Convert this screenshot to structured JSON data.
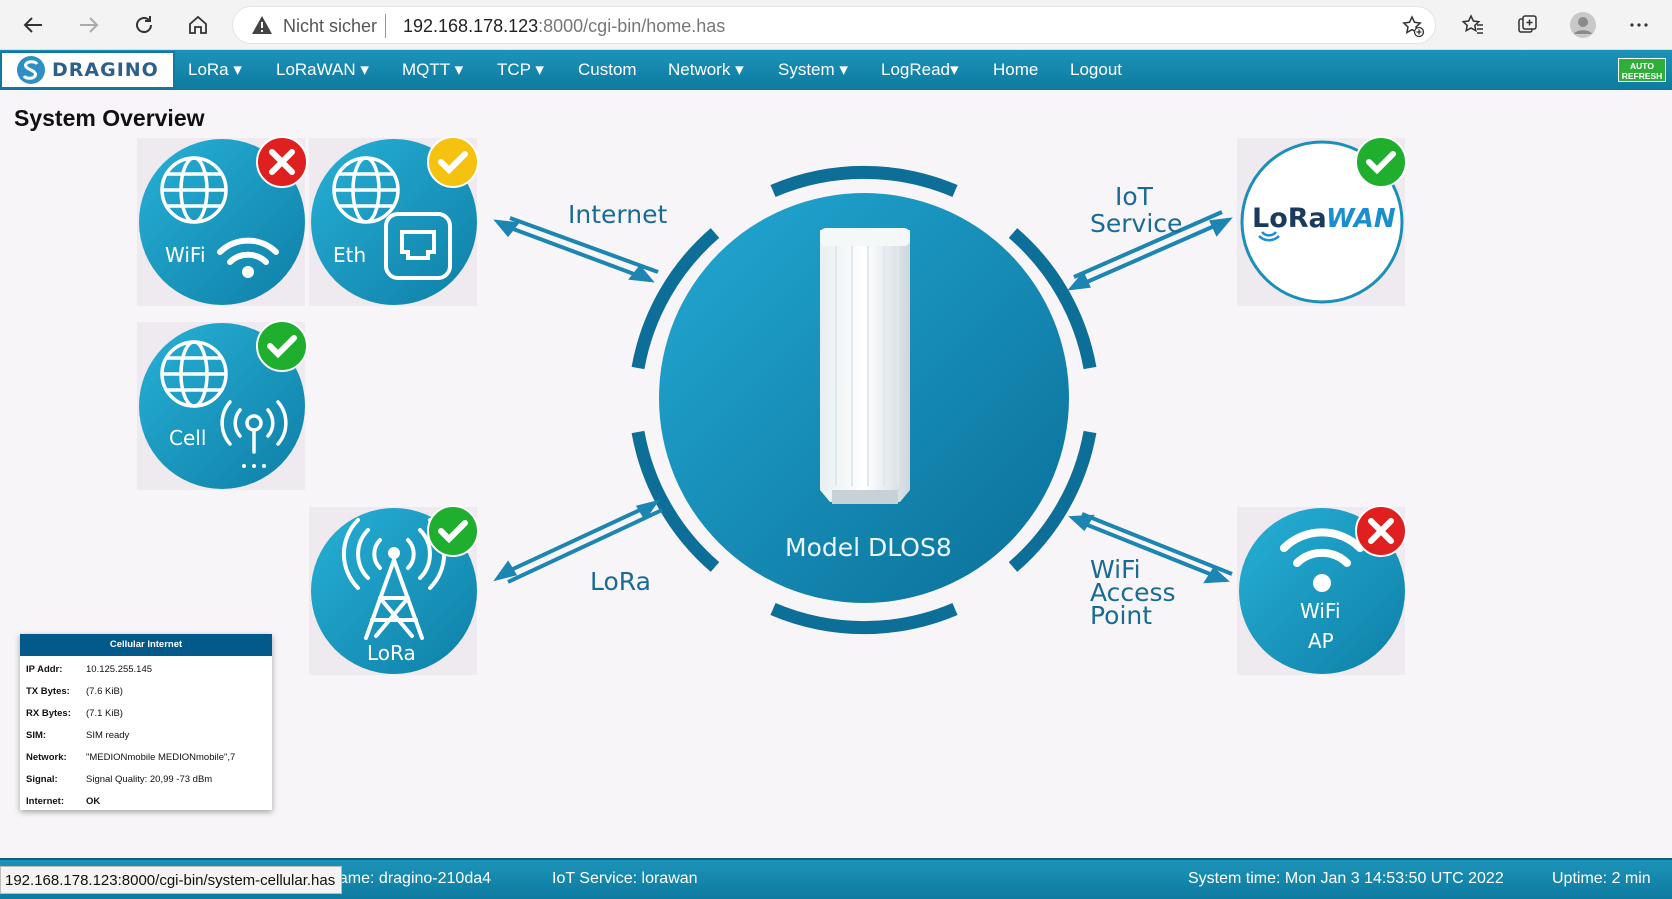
{
  "browser": {
    "security_label": "Nicht sicher",
    "url_host": "192.168.178.123",
    "url_rest": ":8000/cgi-bin/home.has"
  },
  "nav": {
    "logo_text": "DRAGINO",
    "items": [
      {
        "label": "LoRa",
        "dropdown": true
      },
      {
        "label": "LoRaWAN",
        "dropdown": true
      },
      {
        "label": "MQTT",
        "dropdown": true
      },
      {
        "label": "TCP",
        "dropdown": true
      },
      {
        "label": "Custom",
        "dropdown": false
      },
      {
        "label": "Network",
        "dropdown": true
      },
      {
        "label": "System",
        "dropdown": true
      },
      {
        "label": "LogRead",
        "dropdown": true
      },
      {
        "label": "Home",
        "dropdown": false
      },
      {
        "label": "Logout",
        "dropdown": false
      }
    ],
    "auto_refresh_line1": "AUTO",
    "auto_refresh_line2": "REFRESH"
  },
  "page_title": "System Overview",
  "overview": {
    "wifi": {
      "label": "WiFi",
      "status": "error"
    },
    "eth": {
      "label": "Eth",
      "status": "warning"
    },
    "cell": {
      "label": "Cell",
      "status": "ok"
    },
    "lora": {
      "label": "LoRa",
      "status": "ok"
    },
    "lorawan": {
      "logo_left": "LoRa",
      "logo_right": "WAN",
      "status": "ok"
    },
    "wifi_ap": {
      "label_line1": "WiFi",
      "label_line2": "AP",
      "status": "error"
    },
    "device_model": "Model DLOS8",
    "labels": {
      "internet": "Internet",
      "iot_line1": "IoT",
      "iot_line2": "Service",
      "lora": "LoRa",
      "wifi_ap_line1": "WiFi",
      "wifi_ap_line2": "Access",
      "wifi_ap_line3": "Point"
    },
    "status_colors": {
      "ok": "#1fae2e",
      "warning": "#f4c20f",
      "error": "#e02020"
    }
  },
  "cellular": {
    "title": "Cellular Internet",
    "rows": [
      {
        "key": "IP Addr:",
        "value": "10.125.255.145"
      },
      {
        "key": "TX Bytes:",
        "value": "(7.6 KiB)"
      },
      {
        "key": "RX Bytes:",
        "value": "(7.1 KiB)"
      },
      {
        "key": "SIM:",
        "value": "SIM ready"
      },
      {
        "key": "Network:",
        "value": "\"MEDIONmobile MEDIONmobile\",7"
      },
      {
        "key": "Signal:",
        "value": "Signal Quality: 20,99 -73 dBm"
      },
      {
        "key": "Internet:",
        "value": "OK"
      }
    ]
  },
  "statusbar": {
    "hostname": "name: dragino-210da4",
    "iot_service": "IoT Service: lorawan",
    "system_time": "System time: Mon Jan 3 14:53:50 UTC 2022",
    "uptime": "Uptime: 2 min"
  },
  "link_tooltip": "192.168.178.123:8000/cgi-bin/system-cellular.has"
}
